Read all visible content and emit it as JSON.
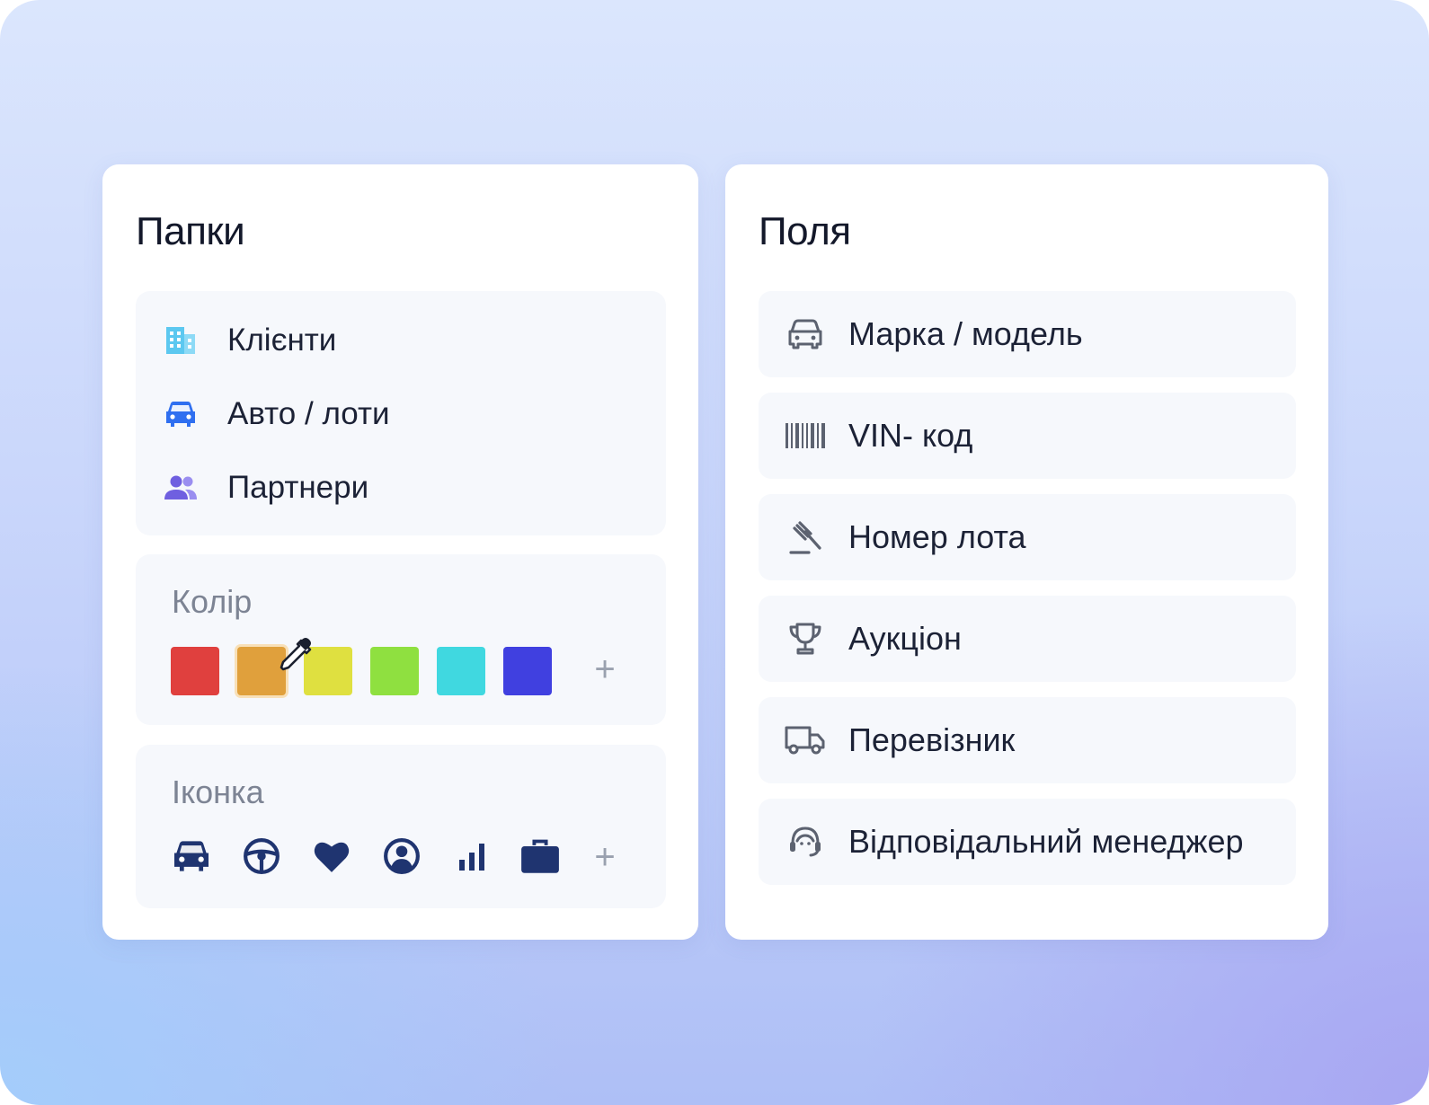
{
  "folders_card": {
    "title": "Папки",
    "folders": [
      {
        "label": "Клієнти",
        "icon": "building-icon",
        "color": "#5cc8f0"
      },
      {
        "label": "Авто / лоти",
        "icon": "car-icon",
        "color": "#2f6ff0"
      },
      {
        "label": "Партнери",
        "icon": "users-icon",
        "color": "#7a6ae6"
      }
    ],
    "color_section": {
      "label": "Колір",
      "swatches": [
        "#e0403e",
        "#e0a03c",
        "#dfe040",
        "#8fe040",
        "#40d8e0",
        "#4040e0"
      ],
      "selected_index": 1,
      "add_label": "+"
    },
    "icon_section": {
      "label": "Іконка",
      "options": [
        "car-icon",
        "steering-wheel-icon",
        "heart-icon",
        "user-circle-icon",
        "bar-chart-icon",
        "briefcase-icon"
      ],
      "icon_color": "#1f3470",
      "add_label": "+"
    }
  },
  "fields_card": {
    "title": "Поля",
    "fields": [
      {
        "label": "Марка / модель",
        "icon": "car-outline-icon"
      },
      {
        "label": "VIN- код",
        "icon": "barcode-icon"
      },
      {
        "label": "Номер лота",
        "icon": "gavel-icon"
      },
      {
        "label": "Аукціон",
        "icon": "trophy-icon"
      },
      {
        "label": "Перевізник",
        "icon": "truck-icon"
      },
      {
        "label": "Відповідальний менеджер",
        "icon": "support-agent-icon"
      }
    ],
    "icon_color": "#5c6270"
  }
}
